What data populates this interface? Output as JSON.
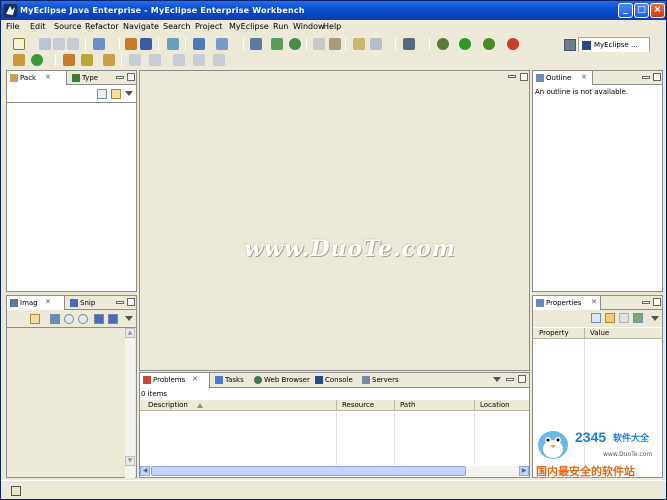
{
  "window": {
    "title": "MyEclipse Java Enterprise - MyEclipse Enterprise Workbench",
    "controls": {
      "minimize": "_",
      "maximize": "□",
      "close": "×"
    }
  },
  "menu": [
    "File",
    "Edit",
    "Source",
    "Refactor",
    "Navigate",
    "Search",
    "Project",
    "MyEclipse",
    "Run",
    "Window",
    "Help"
  ],
  "perspective": {
    "label": "MyEclipse ..."
  },
  "panels": {
    "left_top": {
      "tabs": [
        {
          "label": "Pack",
          "icon": "package-icon"
        },
        {
          "label": "Type",
          "icon": "type-hierarchy-icon"
        }
      ]
    },
    "left_bottom": {
      "tabs": [
        {
          "label": "Imag",
          "icon": "image-icon"
        },
        {
          "label": "Snip",
          "icon": "snippet-icon"
        }
      ]
    },
    "outline": {
      "tab": "Outline",
      "message": "An outline is not available."
    },
    "properties": {
      "tab": "Properties",
      "columns": [
        "Property",
        "Value"
      ]
    },
    "bottom": {
      "tabs": [
        "Problems",
        "Tasks",
        "Web Browser",
        "Console",
        "Servers"
      ],
      "summary": "0 items",
      "columns": [
        "Description",
        "Resource",
        "Path",
        "Location"
      ]
    }
  },
  "watermark": "www.DuoTe.com",
  "site_logo": {
    "number": "2345",
    "name": "软件大全",
    "url": "www.DuoTe.com",
    "slogan": "国内最安全的软件站"
  },
  "colors": {
    "titlebar": "#0a4fd0",
    "chrome": "#ece9d8",
    "panel_border": "#8c8c8c"
  }
}
